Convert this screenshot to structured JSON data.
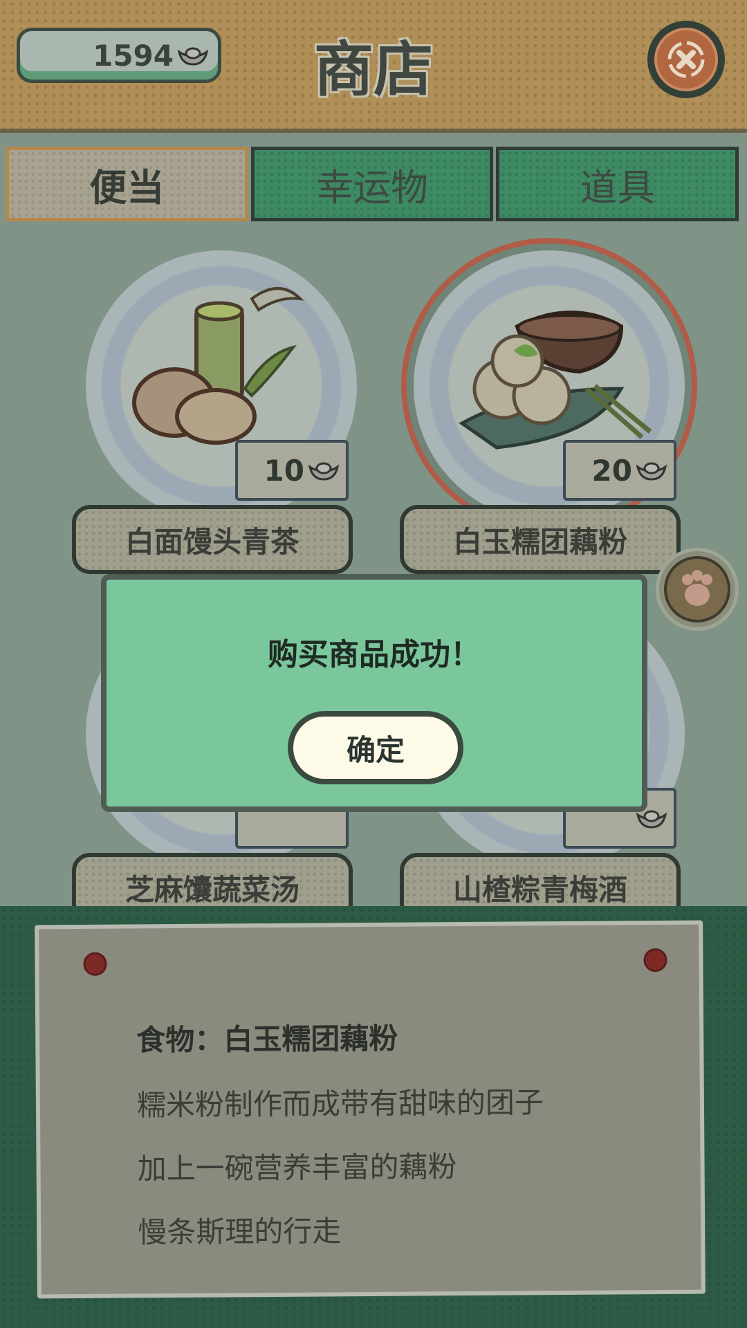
{
  "header": {
    "coins": "1594",
    "title": "商店"
  },
  "tabs": [
    {
      "label": "便当",
      "active": true
    },
    {
      "label": "幸运物",
      "active": false
    },
    {
      "label": "道具",
      "active": false
    }
  ],
  "items": [
    {
      "name": "白面馒头青茶",
      "price": "10",
      "selected": false
    },
    {
      "name": "白玉糯团藕粉",
      "price": "20",
      "selected": true
    },
    {
      "name": "芝麻馕蔬菜汤",
      "price": "",
      "selected": false
    },
    {
      "name": "山楂粽青梅酒",
      "price": "",
      "selected": false
    }
  ],
  "description": {
    "title": "食物：白玉糯团藕粉",
    "lines": [
      "糯米粉制作而成带有甜味的团子",
      "加上一碗营养丰富的藕粉",
      "慢条斯理的行走"
    ]
  },
  "dialog": {
    "message": "购买商品成功！",
    "confirm_label": "确定"
  },
  "colors": {
    "dialog_bg": "#7bc79c",
    "tab_bg": "#3e8a63",
    "selected_ring": "#b05c48"
  },
  "icons": {
    "currency": "ingot-icon",
    "close": "close-icon",
    "side": "paw-icon"
  }
}
